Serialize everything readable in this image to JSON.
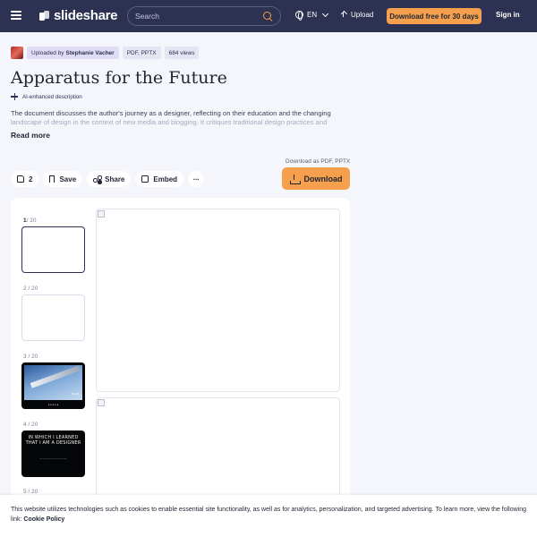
{
  "nav": {
    "logo_text": "slideshare",
    "search_placeholder": "Search",
    "language": "EN",
    "upload_label": "Upload",
    "download_free_label": "Download free for 30 days",
    "signin_label": "Sign in"
  },
  "meta": {
    "uploaded_by_prefix": "Uploaded by",
    "uploader": "Stephanie Vacher",
    "formats": "PDF, PPTX",
    "views": "684 views"
  },
  "doc": {
    "title": "Apparatus for the Future",
    "ai_label": "AI-enhanced description",
    "description_visible": "The document discusses the author's journey as a designer, reflecting on their education and the changing",
    "description_faded": "landscape of design in the context of new media and blogging. It critiques traditional design practices and ...",
    "read_more": "Read more"
  },
  "actions": {
    "likes": "2",
    "save": "Save",
    "share": "Share",
    "embed": "Embed",
    "more": "···",
    "download_as": "Download as PDF, PPTX",
    "download": "Download"
  },
  "viewer": {
    "thumbs": [
      {
        "current": "1",
        "total": "/ 20"
      },
      {
        "current": "2",
        "total": "/ 20"
      },
      {
        "current": "3",
        "total": "/ 20"
      },
      {
        "current": "4",
        "total": "/ 20"
      },
      {
        "current": "5",
        "total": "/ 20"
      }
    ],
    "slide3_caption": "● ● ● ● ●",
    "slide3_mini": "PLAN",
    "slide4_heading": "IN WHICH I LEARNED THAT I AM A DESIGNER",
    "slide4_sub": "— — — — — — — — — —"
  },
  "cookie": {
    "text": "This website utilizes technologies such as cookies to enable essential site functionality, as well as for analytics, personalization, and targeted advertising. To learn more, view the following link: ",
    "link": "Cookie Policy"
  }
}
